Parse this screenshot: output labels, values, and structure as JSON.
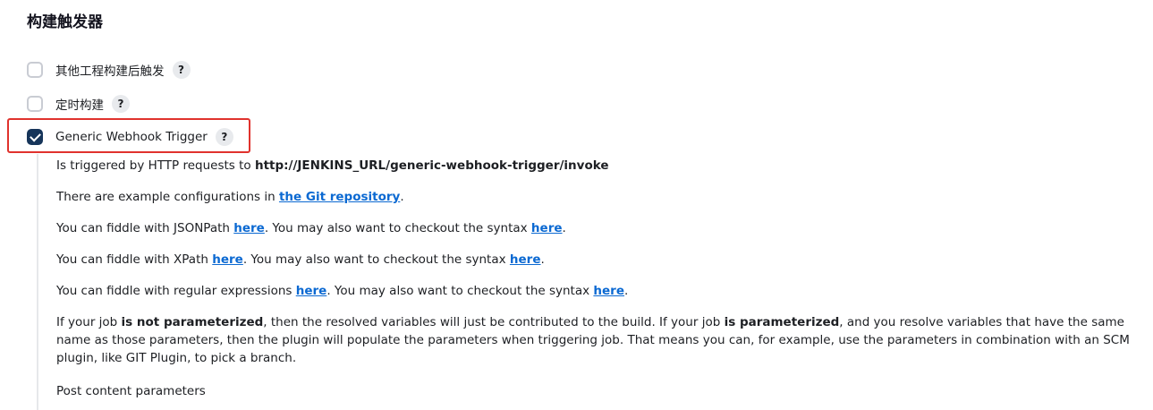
{
  "section": {
    "title": "构建触发器"
  },
  "triggers": [
    {
      "label": "其他工程构建后触发",
      "checked": false,
      "help": "?"
    },
    {
      "label": "定时构建",
      "checked": false,
      "help": "?"
    },
    {
      "label": "Generic Webhook Trigger",
      "checked": true,
      "help": "?"
    }
  ],
  "highlight_color": "#e0322d",
  "description": {
    "line1_prefix": "Is triggered by HTTP requests to ",
    "line1_url": "http://JENKINS_URL/generic-webhook-trigger/invoke",
    "line2_prefix": "There are example configurations in ",
    "line2_link": "the Git repository",
    "line2_suffix": ".",
    "jsonpath": {
      "prefix": "You can fiddle with JSONPath ",
      "link1": "here",
      "middle": ". You may also want to checkout the syntax ",
      "link2": "here",
      "suffix": "."
    },
    "xpath": {
      "prefix": "You can fiddle with XPath ",
      "link1": "here",
      "middle": ". You may also want to checkout the syntax ",
      "link2": "here",
      "suffix": "."
    },
    "regex": {
      "prefix": "You can fiddle with regular expressions ",
      "link1": "here",
      "middle": ". You may also want to checkout the syntax ",
      "link2": "here",
      "suffix": "."
    },
    "param": {
      "t1": "If your job ",
      "b1": "is not parameterized",
      "t2": ", then the resolved variables will just be contributed to the build. If your job ",
      "b2": "is parameterized",
      "t3": ", and you resolve variables that have the same name as those parameters, then the plugin will populate the parameters when triggering job. That means you can, for example, use the parameters in combination with an SCM plugin, like GIT Plugin, to pick a branch."
    },
    "post_content_label": "Post content parameters"
  },
  "colors": {
    "checkbox_checked": "#16355a",
    "link": "#0b69d2"
  }
}
